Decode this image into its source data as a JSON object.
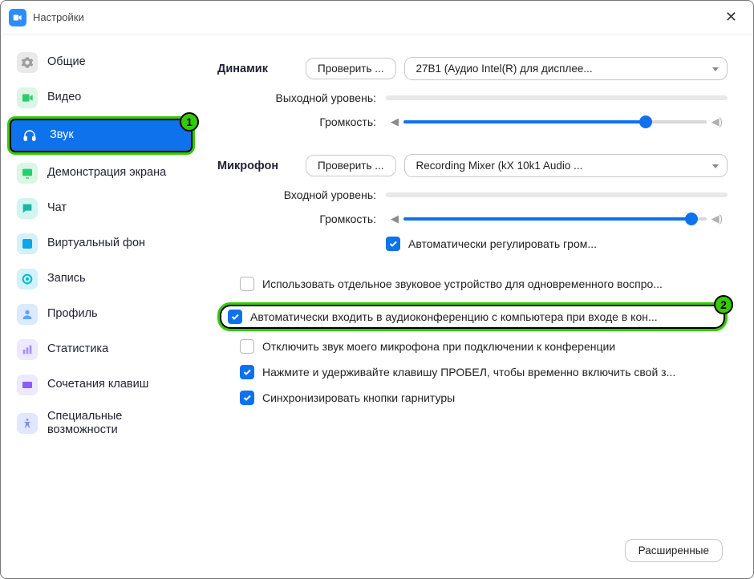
{
  "window": {
    "title": "Настройки"
  },
  "sidebar": {
    "items": [
      {
        "label": "Общие"
      },
      {
        "label": "Видео"
      },
      {
        "label": "Звук"
      },
      {
        "label": "Демонстрация экрана"
      },
      {
        "label": "Чат"
      },
      {
        "label": "Виртуальный фон"
      },
      {
        "label": "Запись"
      },
      {
        "label": "Профиль"
      },
      {
        "label": "Статистика"
      },
      {
        "label": "Сочетания клавиш"
      },
      {
        "label": "Специальные возможности"
      }
    ]
  },
  "badges": {
    "one": "1",
    "two": "2"
  },
  "speaker": {
    "title": "Динамик",
    "test": "Проверить ...",
    "device": "27B1 (Аудио Intel(R) для дисплее...",
    "output_label": "Выходной уровень:",
    "volume_label": "Громкость:",
    "volume_percent": 80
  },
  "mic": {
    "title": "Микрофон",
    "test": "Проверить ...",
    "device": "Recording Mixer (kX 10k1 Audio ...",
    "input_label": "Входной уровень:",
    "volume_label": "Громкость:",
    "volume_percent": 95,
    "auto_adjust": "Автоматически регулировать гром..."
  },
  "options": {
    "separate_device": "Использовать отдельное звуковое устройство для одновременного воспро...",
    "auto_join_audio": "Автоматически входить в аудиоконференцию с компьютера при входе в кон...",
    "mute_on_join": "Отключить звук моего микрофона при подключении к конференции",
    "space_unmute": "Нажмите и удерживайте клавишу ПРОБЕЛ, чтобы временно включить свой з...",
    "sync_headset": "Синхронизировать кнопки гарнитуры"
  },
  "footer": {
    "advanced": "Расширенные"
  },
  "colors": {
    "general": "#d9d9d9",
    "video": "#33d17a",
    "audio": "#ffffff",
    "share": "#2ecc71",
    "chat": "#2dd4bf",
    "vb": "#0ea5e9",
    "record": "#06b6d4",
    "profile": "#60a5fa",
    "stats": "#a78bfa",
    "keys": "#8b5cf6",
    "access": "#818cf8"
  }
}
